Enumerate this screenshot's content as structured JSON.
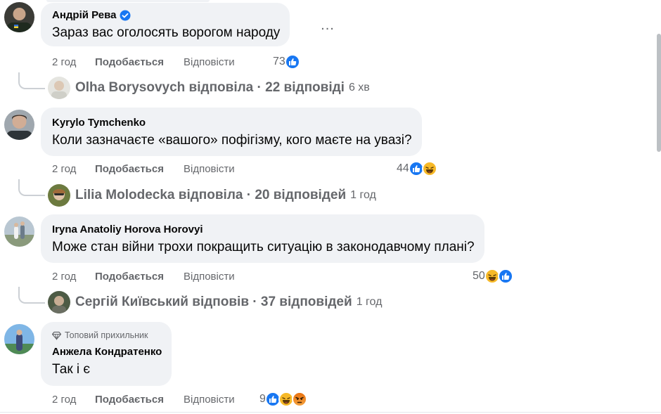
{
  "comments": [
    {
      "author": "Андрій Рева",
      "verified": true,
      "text": "Зараз вас оголосять ворогом народу",
      "time": "2 год",
      "like_label": "Подобається",
      "reply_label": "Відповісти",
      "reaction_count": "73",
      "reactions": [
        "like"
      ],
      "replies": {
        "summary": "Olha Borysovych відповіла · 22 відповіді",
        "time": "6 хв"
      }
    },
    {
      "author": "Kyrylo Tymchenko",
      "text": "Коли зазначаєте «вашого» пофігізму, кого маєте на увазі?",
      "time": "2 год",
      "like_label": "Подобається",
      "reply_label": "Відповісти",
      "reaction_count": "44",
      "reactions": [
        "like",
        "haha"
      ],
      "replies": {
        "summary": "Lilia Molodecka відповіла · 20 відповідей",
        "time": "1 год"
      }
    },
    {
      "author": "Iryna Anatoliy Horova Horovyi",
      "text": "Може стан війни трохи покращить ситуацію в законодавчому плані?",
      "time": "2 год",
      "like_label": "Подобається",
      "reply_label": "Відповісти",
      "reaction_count": "50",
      "reactions": [
        "haha",
        "like"
      ],
      "replies": {
        "summary": "Сергій Київський відповів · 37 відповідей",
        "time": "1 год"
      }
    },
    {
      "badge": "Топовий прихильник",
      "author": "Анжела Кондратенко",
      "text": "Так і є",
      "time": "2 год",
      "like_label": "Подобається",
      "reply_label": "Відповісти",
      "reaction_count": "9",
      "reactions": [
        "like",
        "haha",
        "angry"
      ]
    }
  ],
  "more_button": "...",
  "icons": {
    "verified": "verified-badge-icon",
    "like": "like-reaction-icon",
    "haha": "haha-reaction-icon",
    "angry": "angry-reaction-icon",
    "diamond": "diamond-icon",
    "more": "more-options-icon"
  },
  "colors": {
    "bubble_bg": "#f0f2f5",
    "muted_text": "#65676b",
    "like_blue": "#1877f2",
    "haha_yellow": "#f7b928",
    "angry_red": "#e9710f"
  }
}
